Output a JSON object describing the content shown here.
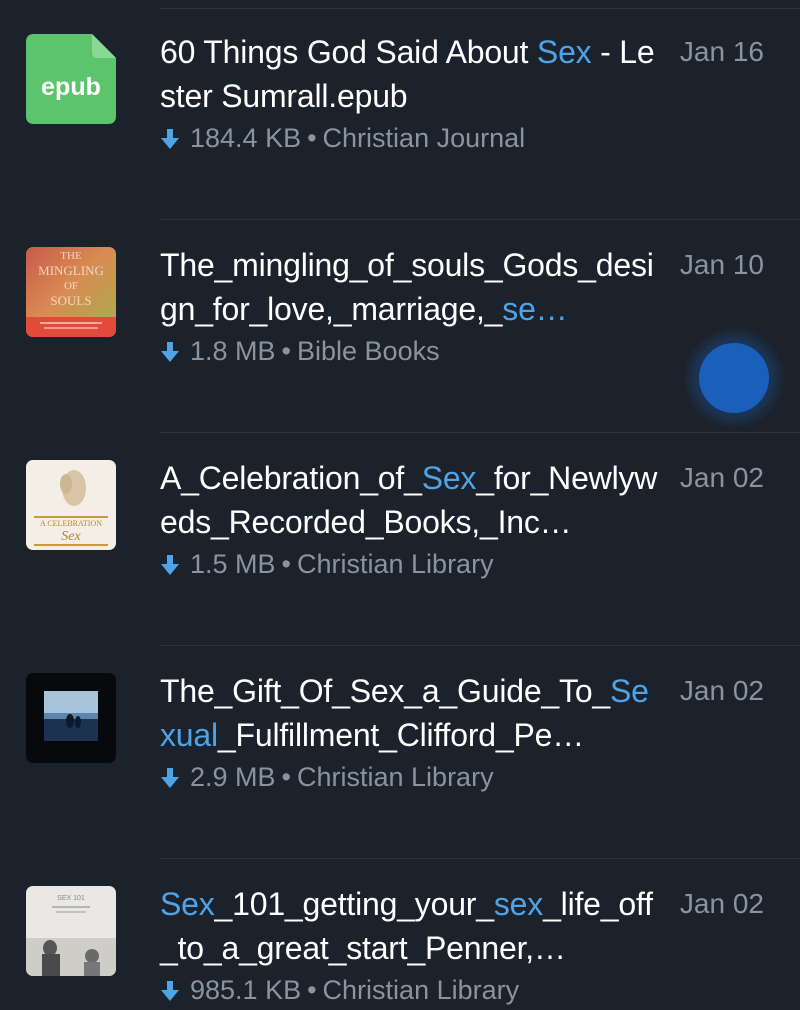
{
  "files": [
    {
      "title_parts": [
        {
          "text": "60 Things God Said About ",
          "hl": false
        },
        {
          "text": "Sex",
          "hl": true
        },
        {
          "text": " - Lester Sumrall.epub",
          "hl": false
        }
      ],
      "date": "Jan 16",
      "size": "184.4 KB",
      "channel": "Christian Journal",
      "thumb": {
        "kind": "epub",
        "label": "epub",
        "color": "#5cc56c"
      }
    },
    {
      "title_parts": [
        {
          "text": "The_mingling_of_souls_Gods_design_for_love,_marriage,_",
          "hl": false
        },
        {
          "text": "se…",
          "hl": true
        }
      ],
      "date": "Jan 10",
      "size": "1.8 MB",
      "channel": "Bible Books",
      "thumb": {
        "kind": "cover-mingling",
        "label": "THE MINGLING OF SOULS"
      }
    },
    {
      "title_parts": [
        {
          "text": "A_Celebration_of_",
          "hl": false
        },
        {
          "text": "Sex",
          "hl": true
        },
        {
          "text": "_for_Newlyweds_Recorded_Books,_Inc…",
          "hl": false
        }
      ],
      "date": "Jan 02",
      "size": "1.5 MB",
      "channel": "Christian Library",
      "thumb": {
        "kind": "cover-celebration",
        "label": "A CELEBRATION OF SEX FOR"
      }
    },
    {
      "title_parts": [
        {
          "text": "The_Gift_Of_Sex_a_Guide_To_",
          "hl": false
        },
        {
          "text": "Sexual",
          "hl": true
        },
        {
          "text": "_Fulfillment_Clifford_Pe…",
          "hl": false
        }
      ],
      "date": "Jan 02",
      "size": "2.9 MB",
      "channel": "Christian Library",
      "thumb": {
        "kind": "cover-gift",
        "label": ""
      }
    },
    {
      "title_parts": [
        {
          "text": "Sex",
          "hl": true
        },
        {
          "text": "_101_getting_your_",
          "hl": false
        },
        {
          "text": "sex",
          "hl": true
        },
        {
          "text": "_life_off_to_a_great_start_Penner,…",
          "hl": false
        }
      ],
      "date": "Jan 02",
      "size": "985.1 KB",
      "channel": "Christian Library",
      "thumb": {
        "kind": "cover-sex101",
        "label": "SEX 101"
      }
    }
  ],
  "separator": "•",
  "icons": {
    "download": "download-arrow-icon"
  },
  "colors": {
    "accent": "#4ea4e6",
    "background": "#1c222b",
    "muted": "#8a949f",
    "fab": "#1a5fba"
  }
}
